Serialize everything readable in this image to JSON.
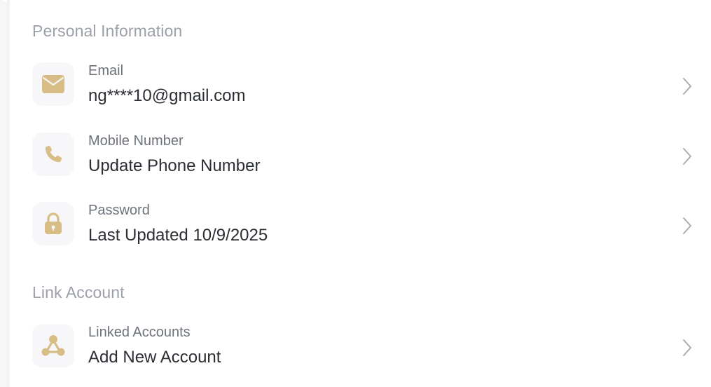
{
  "sections": [
    {
      "title": "Personal Information",
      "items": [
        {
          "label": "Email",
          "value": "ng****10@gmail.com",
          "icon": "envelope-icon"
        },
        {
          "label": "Mobile Number",
          "value": "Update Phone Number",
          "icon": "phone-icon"
        },
        {
          "label": "Password",
          "value": "Last Updated 10/9/2025",
          "icon": "lock-icon"
        }
      ]
    },
    {
      "title": "Link Account",
      "items": [
        {
          "label": "Linked Accounts",
          "value": "Add New Account",
          "icon": "link-accounts-icon"
        }
      ]
    }
  ],
  "colors": {
    "icon_accent": "#d9bd86",
    "icon_bg": "#f7f7f9",
    "section_title": "#9ca0a8",
    "label": "#6e737b",
    "value": "#2b2e33",
    "chevron": "#a9adb3"
  }
}
